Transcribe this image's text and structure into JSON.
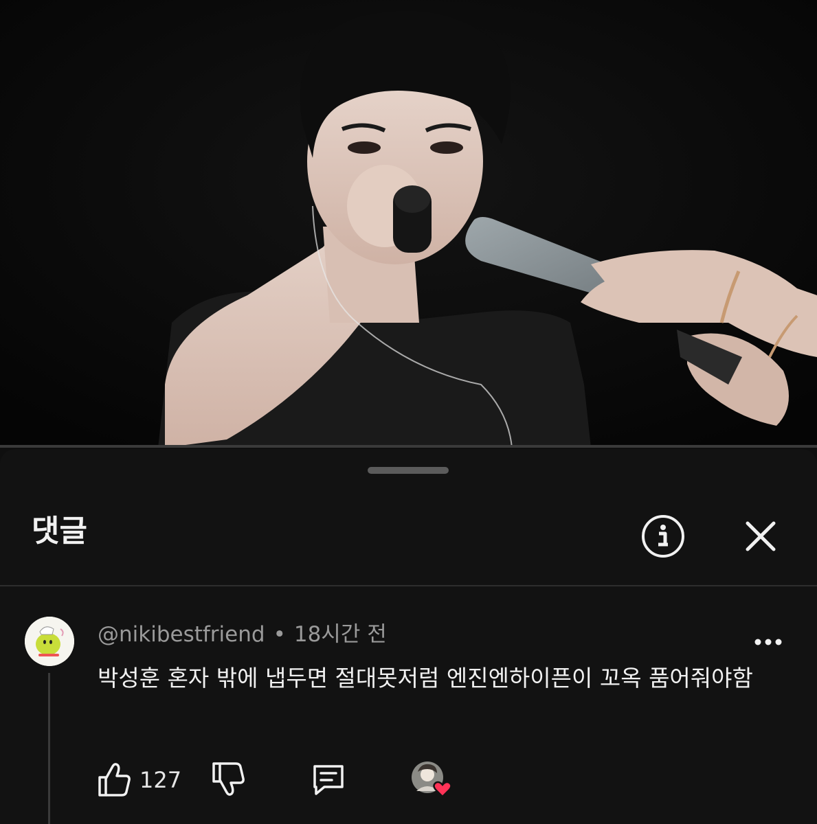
{
  "video": {
    "description_icon": "video-frame"
  },
  "comments_panel": {
    "title": "댓글",
    "info_icon": "info-icon",
    "close_icon": "close-icon"
  },
  "comment": {
    "author": "@nikibestfriend",
    "separator": "•",
    "time": "18시간 전",
    "text": "박성훈 혼자 밖에 냅두면 절대못저럼 엔진엔하이픈이 꼬옥 품어줘야함",
    "like_count": "127",
    "icons": {
      "like": "thumbs-up-icon",
      "dislike": "thumbs-down-icon",
      "reply": "reply-comment-icon",
      "more": "more-options-icon",
      "creator_heart": "creator-heart-icon"
    }
  }
}
